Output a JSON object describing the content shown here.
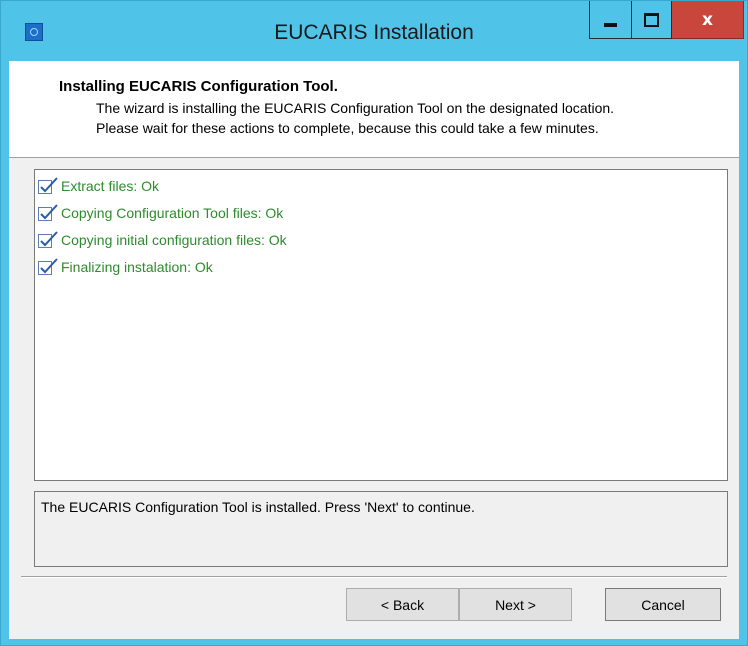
{
  "window": {
    "title": "EUCARIS Installation",
    "caption": {
      "minimize": "minimize",
      "maximize": "maximize",
      "close": "x"
    }
  },
  "header": {
    "title": "Installing EUCARIS Configuration Tool.",
    "description_line1": "The wizard is installing the EUCARIS Configuration Tool on the designated location.",
    "description_line2": "Please wait for these actions to complete, because this could take a few minutes."
  },
  "progress": {
    "items": [
      {
        "label": "Extract files: Ok",
        "icon": "checked-box-icon",
        "color": "#2e8b2e"
      },
      {
        "label": "Copying Configuration Tool files: Ok",
        "icon": "checked-box-icon",
        "color": "#2e8b2e"
      },
      {
        "label": "Copying initial configuration files: Ok",
        "icon": "checked-box-icon",
        "color": "#2e8b2e"
      },
      {
        "label": "Finalizing instalation: Ok",
        "icon": "checked-box-icon",
        "color": "#2e8b2e"
      }
    ]
  },
  "status": {
    "text": "The EUCARIS Configuration Tool is installed. Press 'Next' to continue."
  },
  "buttons": {
    "back": "< Back",
    "next": "Next >",
    "cancel": "Cancel"
  },
  "colors": {
    "titlebar": "#4fc3e8",
    "close_button": "#c9463d",
    "success_text": "#2e8b2e"
  }
}
